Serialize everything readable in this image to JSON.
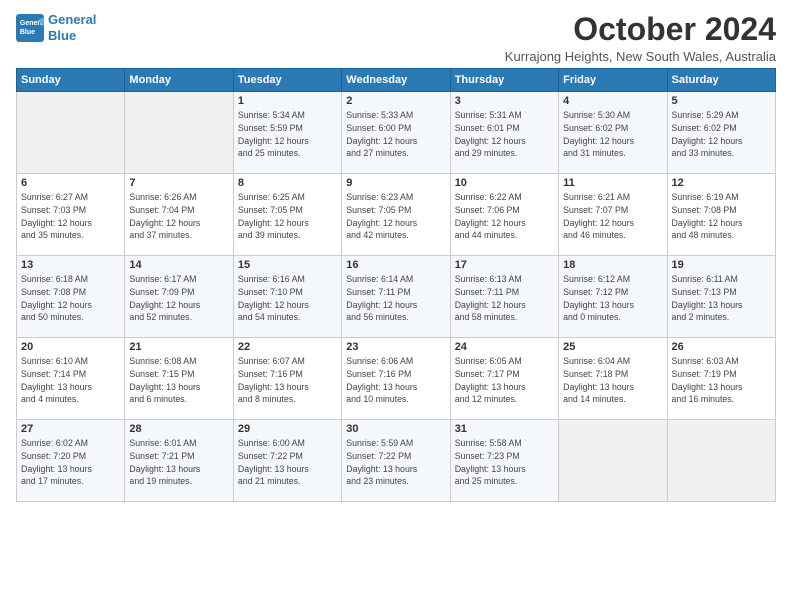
{
  "logo": {
    "line1": "General",
    "line2": "Blue"
  },
  "title": "October 2024",
  "subtitle": "Kurrajong Heights, New South Wales, Australia",
  "weekdays": [
    "Sunday",
    "Monday",
    "Tuesday",
    "Wednesday",
    "Thursday",
    "Friday",
    "Saturday"
  ],
  "weeks": [
    [
      {
        "day": "",
        "info": ""
      },
      {
        "day": "",
        "info": ""
      },
      {
        "day": "1",
        "info": "Sunrise: 5:34 AM\nSunset: 5:59 PM\nDaylight: 12 hours\nand 25 minutes."
      },
      {
        "day": "2",
        "info": "Sunrise: 5:33 AM\nSunset: 6:00 PM\nDaylight: 12 hours\nand 27 minutes."
      },
      {
        "day": "3",
        "info": "Sunrise: 5:31 AM\nSunset: 6:01 PM\nDaylight: 12 hours\nand 29 minutes."
      },
      {
        "day": "4",
        "info": "Sunrise: 5:30 AM\nSunset: 6:02 PM\nDaylight: 12 hours\nand 31 minutes."
      },
      {
        "day": "5",
        "info": "Sunrise: 5:29 AM\nSunset: 6:02 PM\nDaylight: 12 hours\nand 33 minutes."
      }
    ],
    [
      {
        "day": "6",
        "info": "Sunrise: 6:27 AM\nSunset: 7:03 PM\nDaylight: 12 hours\nand 35 minutes."
      },
      {
        "day": "7",
        "info": "Sunrise: 6:26 AM\nSunset: 7:04 PM\nDaylight: 12 hours\nand 37 minutes."
      },
      {
        "day": "8",
        "info": "Sunrise: 6:25 AM\nSunset: 7:05 PM\nDaylight: 12 hours\nand 39 minutes."
      },
      {
        "day": "9",
        "info": "Sunrise: 6:23 AM\nSunset: 7:05 PM\nDaylight: 12 hours\nand 42 minutes."
      },
      {
        "day": "10",
        "info": "Sunrise: 6:22 AM\nSunset: 7:06 PM\nDaylight: 12 hours\nand 44 minutes."
      },
      {
        "day": "11",
        "info": "Sunrise: 6:21 AM\nSunset: 7:07 PM\nDaylight: 12 hours\nand 46 minutes."
      },
      {
        "day": "12",
        "info": "Sunrise: 6:19 AM\nSunset: 7:08 PM\nDaylight: 12 hours\nand 48 minutes."
      }
    ],
    [
      {
        "day": "13",
        "info": "Sunrise: 6:18 AM\nSunset: 7:08 PM\nDaylight: 12 hours\nand 50 minutes."
      },
      {
        "day": "14",
        "info": "Sunrise: 6:17 AM\nSunset: 7:09 PM\nDaylight: 12 hours\nand 52 minutes."
      },
      {
        "day": "15",
        "info": "Sunrise: 6:16 AM\nSunset: 7:10 PM\nDaylight: 12 hours\nand 54 minutes."
      },
      {
        "day": "16",
        "info": "Sunrise: 6:14 AM\nSunset: 7:11 PM\nDaylight: 12 hours\nand 56 minutes."
      },
      {
        "day": "17",
        "info": "Sunrise: 6:13 AM\nSunset: 7:11 PM\nDaylight: 12 hours\nand 58 minutes."
      },
      {
        "day": "18",
        "info": "Sunrise: 6:12 AM\nSunset: 7:12 PM\nDaylight: 13 hours\nand 0 minutes."
      },
      {
        "day": "19",
        "info": "Sunrise: 6:11 AM\nSunset: 7:13 PM\nDaylight: 13 hours\nand 2 minutes."
      }
    ],
    [
      {
        "day": "20",
        "info": "Sunrise: 6:10 AM\nSunset: 7:14 PM\nDaylight: 13 hours\nand 4 minutes."
      },
      {
        "day": "21",
        "info": "Sunrise: 6:08 AM\nSunset: 7:15 PM\nDaylight: 13 hours\nand 6 minutes."
      },
      {
        "day": "22",
        "info": "Sunrise: 6:07 AM\nSunset: 7:16 PM\nDaylight: 13 hours\nand 8 minutes."
      },
      {
        "day": "23",
        "info": "Sunrise: 6:06 AM\nSunset: 7:16 PM\nDaylight: 13 hours\nand 10 minutes."
      },
      {
        "day": "24",
        "info": "Sunrise: 6:05 AM\nSunset: 7:17 PM\nDaylight: 13 hours\nand 12 minutes."
      },
      {
        "day": "25",
        "info": "Sunrise: 6:04 AM\nSunset: 7:18 PM\nDaylight: 13 hours\nand 14 minutes."
      },
      {
        "day": "26",
        "info": "Sunrise: 6:03 AM\nSunset: 7:19 PM\nDaylight: 13 hours\nand 16 minutes."
      }
    ],
    [
      {
        "day": "27",
        "info": "Sunrise: 6:02 AM\nSunset: 7:20 PM\nDaylight: 13 hours\nand 17 minutes."
      },
      {
        "day": "28",
        "info": "Sunrise: 6:01 AM\nSunset: 7:21 PM\nDaylight: 13 hours\nand 19 minutes."
      },
      {
        "day": "29",
        "info": "Sunrise: 6:00 AM\nSunset: 7:22 PM\nDaylight: 13 hours\nand 21 minutes."
      },
      {
        "day": "30",
        "info": "Sunrise: 5:59 AM\nSunset: 7:22 PM\nDaylight: 13 hours\nand 23 minutes."
      },
      {
        "day": "31",
        "info": "Sunrise: 5:58 AM\nSunset: 7:23 PM\nDaylight: 13 hours\nand 25 minutes."
      },
      {
        "day": "",
        "info": ""
      },
      {
        "day": "",
        "info": ""
      }
    ]
  ]
}
